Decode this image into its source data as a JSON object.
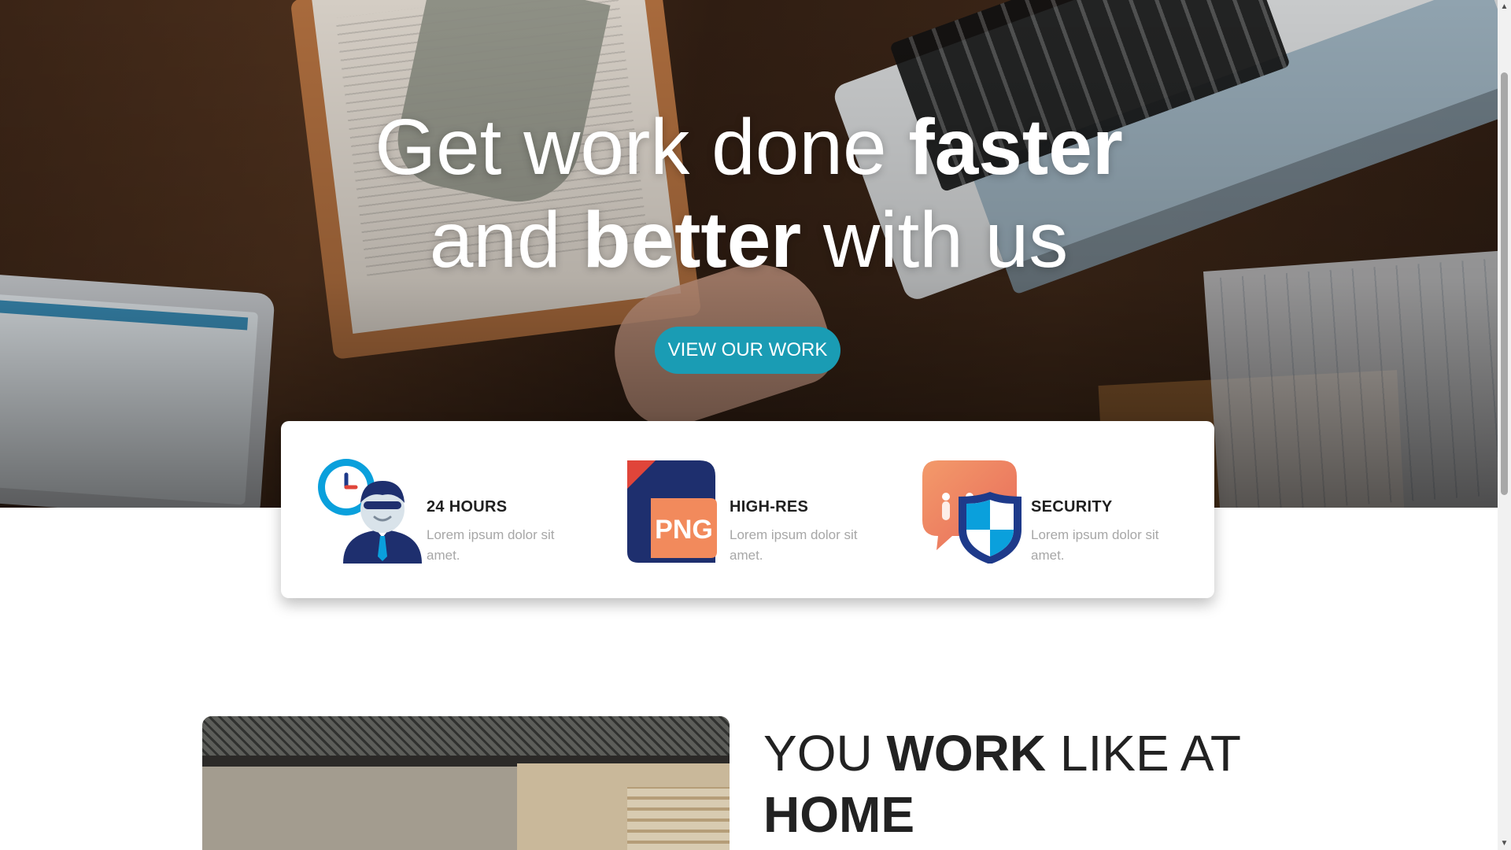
{
  "hero": {
    "headline_line1_part1": "Get work done ",
    "headline_line1_bold": "faster",
    "headline_line2_part1": "and ",
    "headline_line2_bold": "better",
    "headline_line2_part2": " with us",
    "cta_label": "VIEW OUR WORK"
  },
  "features": [
    {
      "title": "24 HOURS",
      "description": "Lorem ipsum dolor sit amet.",
      "icon": "clock-support-agent-icon"
    },
    {
      "title": "HIGH-RES",
      "description": "Lorem ipsum dolor sit amet.",
      "icon": "png-file-icon",
      "icon_text": "PNG"
    },
    {
      "title": "SECURITY",
      "description": "Lorem ipsum dolor sit amet.",
      "icon": "chat-shield-icon"
    }
  ],
  "section": {
    "title_part1": "YOU ",
    "title_bold1": "WORK",
    "title_part2": " LIKE AT ",
    "title_bold2": "HOME"
  },
  "colors": {
    "accent": "#1a9cb4",
    "title_text": "#1f1f1f",
    "muted_text": "#a7a7a7",
    "png_orange": "#f28a5c",
    "security_coral": "#ee7b63",
    "shield_navy": "#1e3a8a"
  }
}
